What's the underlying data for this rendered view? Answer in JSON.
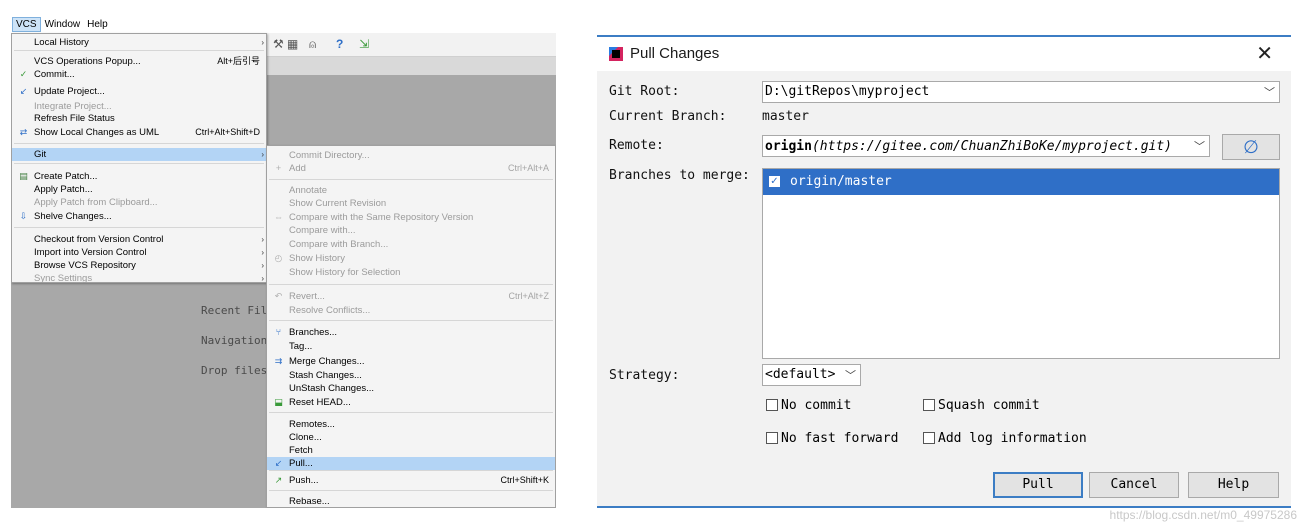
{
  "ide": {
    "menubar": [
      "VCS",
      "Window",
      "Help"
    ],
    "welcome": [
      "Recent Fil",
      "Navigation",
      "Drop files"
    ]
  },
  "vcs_menu": {
    "items": [
      {
        "label": "Local History",
        "shortcut": "",
        "disabled": false,
        "icon": "",
        "submenu": true
      },
      {
        "label": "VCS Operations Popup...",
        "shortcut": "Alt+后引号",
        "disabled": false,
        "icon": ""
      },
      {
        "label": "Commit...",
        "shortcut": "",
        "disabled": false,
        "icon": "commit-icon"
      },
      {
        "label": "Update Project...",
        "shortcut": "",
        "disabled": false,
        "icon": "update-icon"
      },
      {
        "label": "Integrate Project...",
        "shortcut": "",
        "disabled": true,
        "icon": ""
      },
      {
        "label": "Refresh File Status",
        "shortcut": "",
        "disabled": false,
        "icon": ""
      },
      {
        "label": "Show Local Changes as UML",
        "shortcut": "Ctrl+Alt+Shift+D",
        "disabled": false,
        "icon": "uml-icon"
      },
      {
        "label": "Git",
        "shortcut": "",
        "disabled": false,
        "icon": "",
        "selected": true,
        "submenu": true
      },
      {
        "label": "Create Patch...",
        "shortcut": "",
        "disabled": false,
        "icon": "patch-icon"
      },
      {
        "label": "Apply Patch...",
        "shortcut": "",
        "disabled": false,
        "icon": ""
      },
      {
        "label": "Apply Patch from Clipboard...",
        "shortcut": "",
        "disabled": true,
        "icon": ""
      },
      {
        "label": "Shelve Changes...",
        "shortcut": "",
        "disabled": false,
        "icon": "shelve-icon"
      },
      {
        "label": "Checkout from Version Control",
        "shortcut": "",
        "disabled": false,
        "icon": "",
        "submenu": true
      },
      {
        "label": "Import into Version Control",
        "shortcut": "",
        "disabled": false,
        "icon": "",
        "submenu": true
      },
      {
        "label": "Browse VCS Repository",
        "shortcut": "",
        "disabled": false,
        "icon": "",
        "submenu": true
      },
      {
        "label": "Sync Settings",
        "shortcut": "",
        "disabled": true,
        "icon": "",
        "submenu": true
      }
    ]
  },
  "git_menu": {
    "items": [
      {
        "label": "Commit Directory...",
        "shortcut": "",
        "disabled": true,
        "icon": ""
      },
      {
        "label": "Add",
        "shortcut": "Ctrl+Alt+A",
        "disabled": true,
        "icon": "add-icon"
      },
      {
        "label": "Annotate",
        "shortcut": "",
        "disabled": true,
        "icon": ""
      },
      {
        "label": "Show Current Revision",
        "shortcut": "",
        "disabled": true,
        "icon": ""
      },
      {
        "label": "Compare with the Same Repository Version",
        "shortcut": "",
        "disabled": true,
        "icon": "compare-icon"
      },
      {
        "label": "Compare with...",
        "shortcut": "",
        "disabled": true,
        "icon": ""
      },
      {
        "label": "Compare with Branch...",
        "shortcut": "",
        "disabled": true,
        "icon": ""
      },
      {
        "label": "Show History",
        "shortcut": "",
        "disabled": true,
        "icon": "history-icon"
      },
      {
        "label": "Show History for Selection",
        "shortcut": "",
        "disabled": true,
        "icon": ""
      },
      {
        "label": "Revert...",
        "shortcut": "Ctrl+Alt+Z",
        "disabled": true,
        "icon": "revert-icon"
      },
      {
        "label": "Resolve Conflicts...",
        "shortcut": "",
        "disabled": true,
        "icon": ""
      },
      {
        "label": "Branches...",
        "shortcut": "",
        "disabled": false,
        "icon": "branches-icon"
      },
      {
        "label": "Tag...",
        "shortcut": "",
        "disabled": false,
        "icon": ""
      },
      {
        "label": "Merge Changes...",
        "shortcut": "",
        "disabled": false,
        "icon": "merge-icon"
      },
      {
        "label": "Stash Changes...",
        "shortcut": "",
        "disabled": false,
        "icon": ""
      },
      {
        "label": "UnStash Changes...",
        "shortcut": "",
        "disabled": false,
        "icon": ""
      },
      {
        "label": "Reset HEAD...",
        "shortcut": "",
        "disabled": false,
        "icon": "reset-icon"
      },
      {
        "label": "Remotes...",
        "shortcut": "",
        "disabled": false,
        "icon": ""
      },
      {
        "label": "Clone...",
        "shortcut": "",
        "disabled": false,
        "icon": ""
      },
      {
        "label": "Fetch",
        "shortcut": "",
        "disabled": false,
        "icon": ""
      },
      {
        "label": "Pull...",
        "shortcut": "",
        "disabled": false,
        "icon": "pull-icon",
        "selected": true
      },
      {
        "label": "Push...",
        "shortcut": "Ctrl+Shift+K",
        "disabled": false,
        "icon": "push-icon"
      },
      {
        "label": "Rebase...",
        "shortcut": "",
        "disabled": false,
        "icon": ""
      }
    ]
  },
  "dialog": {
    "title": "Pull Changes",
    "close_glyph": "✕",
    "git_root_label": "Git Root:",
    "git_root_value": "D:\\gitRepos\\myproject",
    "current_branch_label": "Current Branch:",
    "current_branch_value": "master",
    "remote_label": "Remote:",
    "remote_name": "origin",
    "remote_url": "(https://gitee.com/ChuanZhiBoKe/myproject.git)",
    "branches_label": "Branches to merge:",
    "branch_item": "origin/master",
    "strategy_label": "Strategy:",
    "strategy_value": "<default>",
    "options": {
      "no_commit": "No commit",
      "squash_commit": "Squash commit",
      "no_fast_forward": "No fast forward",
      "add_log_information": "Add log information"
    },
    "buttons": {
      "pull": "Pull",
      "cancel": "Cancel",
      "help": "Help"
    }
  },
  "watermark": "https://blog.csdn.net/m0_49975286",
  "colors": {
    "accent": "#3c7dc4",
    "selection": "#2f6fc7",
    "menu_selection": "#b3d4f5"
  }
}
